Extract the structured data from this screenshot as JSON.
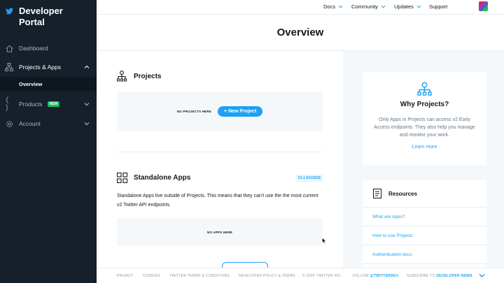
{
  "sidebar": {
    "brand": "Developer Portal",
    "items": [
      {
        "label": "Dashboard"
      },
      {
        "label": "Projects & Apps"
      },
      {
        "label": "Overview"
      },
      {
        "label": "Products",
        "badge": "NEW"
      },
      {
        "label": "Account"
      }
    ]
  },
  "topnav": {
    "docs": "Docs",
    "community": "Community",
    "updates": "Updates",
    "support": "Support"
  },
  "page": {
    "title": "Overview"
  },
  "projects": {
    "title": "Projects",
    "empty_label": "NO PROJECTS HERE",
    "new_button": "+ New Project"
  },
  "standalone": {
    "title": "Standalone Apps",
    "badge": "V1.1 ACCESS",
    "description": "Standalone Apps live outside of Projects. This means that they can't use the the most current v2 Twitter API endpoints.",
    "empty_label": "NO APPS HERE"
  },
  "why": {
    "title": "Why Projects?",
    "text": "Only Apps in Projects can access v2 Early Access endpoints. They also help you manage and monitor your work.",
    "link": "Learn more"
  },
  "resources": {
    "title": "Resources",
    "links": [
      "What are Apps?",
      "How to use Projects",
      "Authentication docs"
    ]
  },
  "footer": {
    "privacy": "PRIVACY",
    "cookies": "COOKIES",
    "terms": "TWITTER TERMS & CONDITIONS",
    "policy": "DEVELOPER POLICY & TERMS",
    "copyright": "© 2020 TWITTER INC.",
    "follow": "FOLLOW",
    "handle": "@TWITTERDEV",
    "subscribe": "SUBSCRIBE TO",
    "news": "DEVELOPER NEWS"
  },
  "colors": {
    "accent": "#1da1f2",
    "sidebar_bg": "#15202b",
    "new_badge": "#17bf63"
  }
}
